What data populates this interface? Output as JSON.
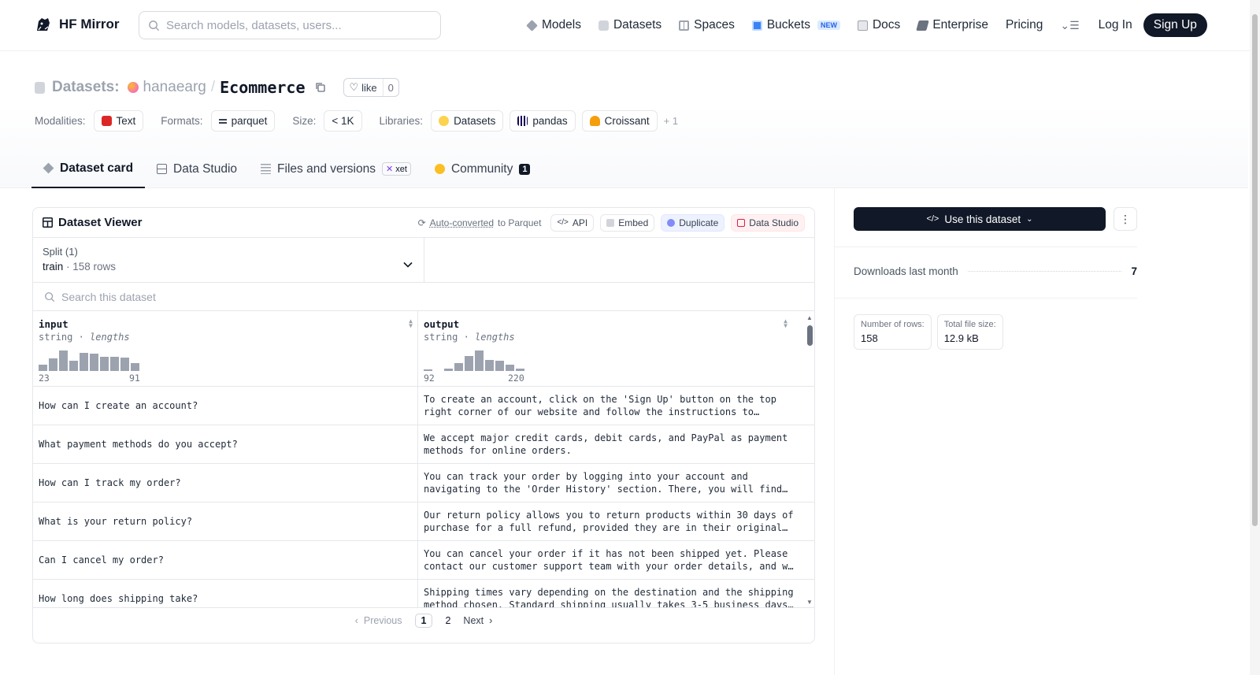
{
  "nav": {
    "brand": "HF Mirror",
    "search_placeholder": "Search models, datasets, users...",
    "links": [
      {
        "label": "Models",
        "icon": "cube-icon",
        "color": "#6b7280"
      },
      {
        "label": "Datasets",
        "icon": "database-icon",
        "color": "#9ca3af"
      },
      {
        "label": "Spaces",
        "icon": "grid-icon",
        "color": "#9ca3af"
      },
      {
        "label": "Buckets",
        "icon": "bucket-icon",
        "color": "#3b82f6"
      },
      {
        "label": "Docs",
        "icon": "book-icon",
        "color": "#9ca3af"
      },
      {
        "label": "Enterprise",
        "icon": "enterprise-icon",
        "color": "#6b7280"
      },
      {
        "label": "Pricing"
      }
    ],
    "buckets_badge": "NEW",
    "login": "Log In",
    "signup": "Sign Up"
  },
  "repo": {
    "type_label": "Datasets:",
    "owner": "hanaearg",
    "name": "Ecommerce",
    "like_label": "like",
    "like_count": "0"
  },
  "meta": {
    "modalities_label": "Modalities:",
    "modality": "Text",
    "formats_label": "Formats:",
    "format": "parquet",
    "size_label": "Size:",
    "size": "< 1K",
    "libraries_label": "Libraries:",
    "libraries": [
      "Datasets",
      "pandas",
      "Croissant"
    ],
    "more": "+ 1"
  },
  "tabs": {
    "card": "Dataset card",
    "studio": "Data Studio",
    "files": "Files and versions",
    "xet": "xet",
    "community": "Community",
    "community_count": "1"
  },
  "viewer": {
    "title": "Dataset Viewer",
    "auto_converted": "Auto-converted",
    "to_parquet": "to Parquet",
    "api": "API",
    "embed": "Embed",
    "duplicate": "Duplicate",
    "data_studio": "Data Studio",
    "split_label": "Split (1)",
    "split_name": "train",
    "split_rows": "158 rows",
    "search_placeholder": "Search this dataset",
    "columns": [
      {
        "name": "input",
        "type": "string",
        "stat": "lengths",
        "min": "23",
        "max": "91",
        "hist": [
          0.3,
          0.6,
          1.0,
          0.5,
          0.9,
          0.85,
          0.7,
          0.7,
          0.65,
          0.4
        ]
      },
      {
        "name": "output",
        "type": "string",
        "stat": "lengths",
        "min": "92",
        "max": "220",
        "hist": [
          0.08,
          0.0,
          0.1,
          0.4,
          0.75,
          1.0,
          0.55,
          0.5,
          0.3,
          0.1
        ]
      }
    ],
    "rows": [
      {
        "input": "How can I create an account?",
        "output": "To create an account, click on the 'Sign Up' button on the top right corner of our website and follow the instructions to…"
      },
      {
        "input": "What payment methods do you accept?",
        "output": "We accept major credit cards, debit cards, and PayPal as payment methods for online orders."
      },
      {
        "input": "How can I track my order?",
        "output": "You can track your order by logging into your account and navigating to the 'Order History' section. There, you will find…"
      },
      {
        "input": "What is your return policy?",
        "output": "Our return policy allows you to return products within 30 days of purchase for a full refund, provided they are in their original…"
      },
      {
        "input": "Can I cancel my order?",
        "output": "You can cancel your order if it has not been shipped yet. Please contact our customer support team with your order details, and w…"
      },
      {
        "input": "How long does shipping take?",
        "output": "Shipping times vary depending on the destination and the shipping method chosen. Standard shipping usually takes 3-5 business days…"
      }
    ],
    "pager": {
      "prev": "Previous",
      "pages": [
        "1",
        "2"
      ],
      "next": "Next"
    }
  },
  "sidebar": {
    "use_button": "Use this dataset",
    "downloads_label": "Downloads last month",
    "downloads": "7",
    "rows_label": "Number of rows:",
    "rows_value": "158",
    "size_label": "Total file size:",
    "size_value": "12.9 kB"
  }
}
